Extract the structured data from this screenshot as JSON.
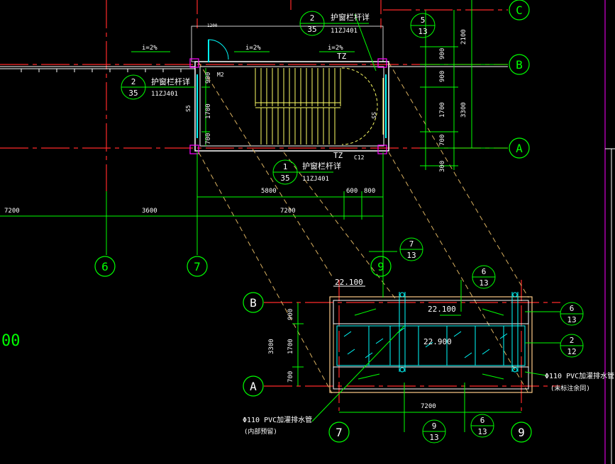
{
  "drawing": {
    "colors": {
      "background": "#000000",
      "grid_axis": "#ff2a2a",
      "dimension": "#00ff00",
      "wall": "#ffffff",
      "stair": "#ffff66",
      "window": "#00ffff",
      "slab": "#ffcc88",
      "projection": "#d8b060",
      "drain_pipe": "#00ffff"
    },
    "axis_bubbles": {
      "top_c": "C",
      "b_right": "B",
      "a_right": "A",
      "ax6": "6",
      "ax7": "7",
      "ax9": "9",
      "b_lower": "B",
      "a_lower": "A",
      "ax7_lower": "7",
      "ax9_lower": "9"
    },
    "detail_refs": {
      "top_2_35": {
        "num": "2",
        "sheet": "35"
      },
      "top_5_13": {
        "num": "5",
        "sheet": "13"
      },
      "left_2_35": {
        "num": "2",
        "sheet": "35"
      },
      "mid_1_35": {
        "num": "1",
        "sheet": "35"
      },
      "ref_7_13": {
        "num": "7",
        "sheet": "13"
      },
      "ref_6_13_top": {
        "num": "6",
        "sheet": "13"
      },
      "ref_6_13_right": {
        "num": "6",
        "sheet": "13"
      },
      "ref_2_12": {
        "num": "2",
        "sheet": "12"
      },
      "ref_9_13": {
        "num": "9",
        "sheet": "13"
      },
      "ref_6_13_bottom": {
        "num": "6",
        "sheet": "13"
      }
    },
    "labels": {
      "railing_top": "护窗栏杆详",
      "railing_top_code": "11ZJ401",
      "railing_left": "护窗栏杆详",
      "railing_left_code": "11ZJ401",
      "railing_mid": "护窗栏杆详",
      "railing_mid_code": "11ZJ401",
      "slope_1": "i=2%",
      "slope_2": "i=2%",
      "slope_3": "i=2%",
      "tz_top": "TZ",
      "tz_bottom": "TZ",
      "door_code": "M2",
      "window_c12": "C12",
      "dim_door_top": "1200",
      "side_s_left": "S5",
      "side_s_right": "S5",
      "pipe_left": "Φ110 PVC加灌排水管",
      "pipe_left_note": "(内部预留)",
      "pipe_right": "Φ110 PVC加灌排水管",
      "pipe_right_note": "(未标注余同)",
      "left_edge_mark": "00"
    },
    "elevations": {
      "elev_22100_a": "22.100",
      "elev_22100_b": "22.100",
      "elev_22900": "22.900"
    },
    "dimensions": {
      "right_2100": "2100",
      "right_900": "900",
      "right_900b": "900",
      "right_1700": "1700",
      "right_3300": "3300",
      "right_700": "700",
      "right_300": "300",
      "stair_900": "900",
      "stair_1700": "1700",
      "stair_700": "700",
      "h_5800": "5800",
      "h_600": "600",
      "h_800": "800",
      "h_7200_left": "7200",
      "h_3600": "3600",
      "h_7200_mid": "7200",
      "roof_900": "900",
      "roof_3300": "3300",
      "roof_1700": "1700",
      "roof_700": "700",
      "roof_7200": "7200"
    }
  }
}
